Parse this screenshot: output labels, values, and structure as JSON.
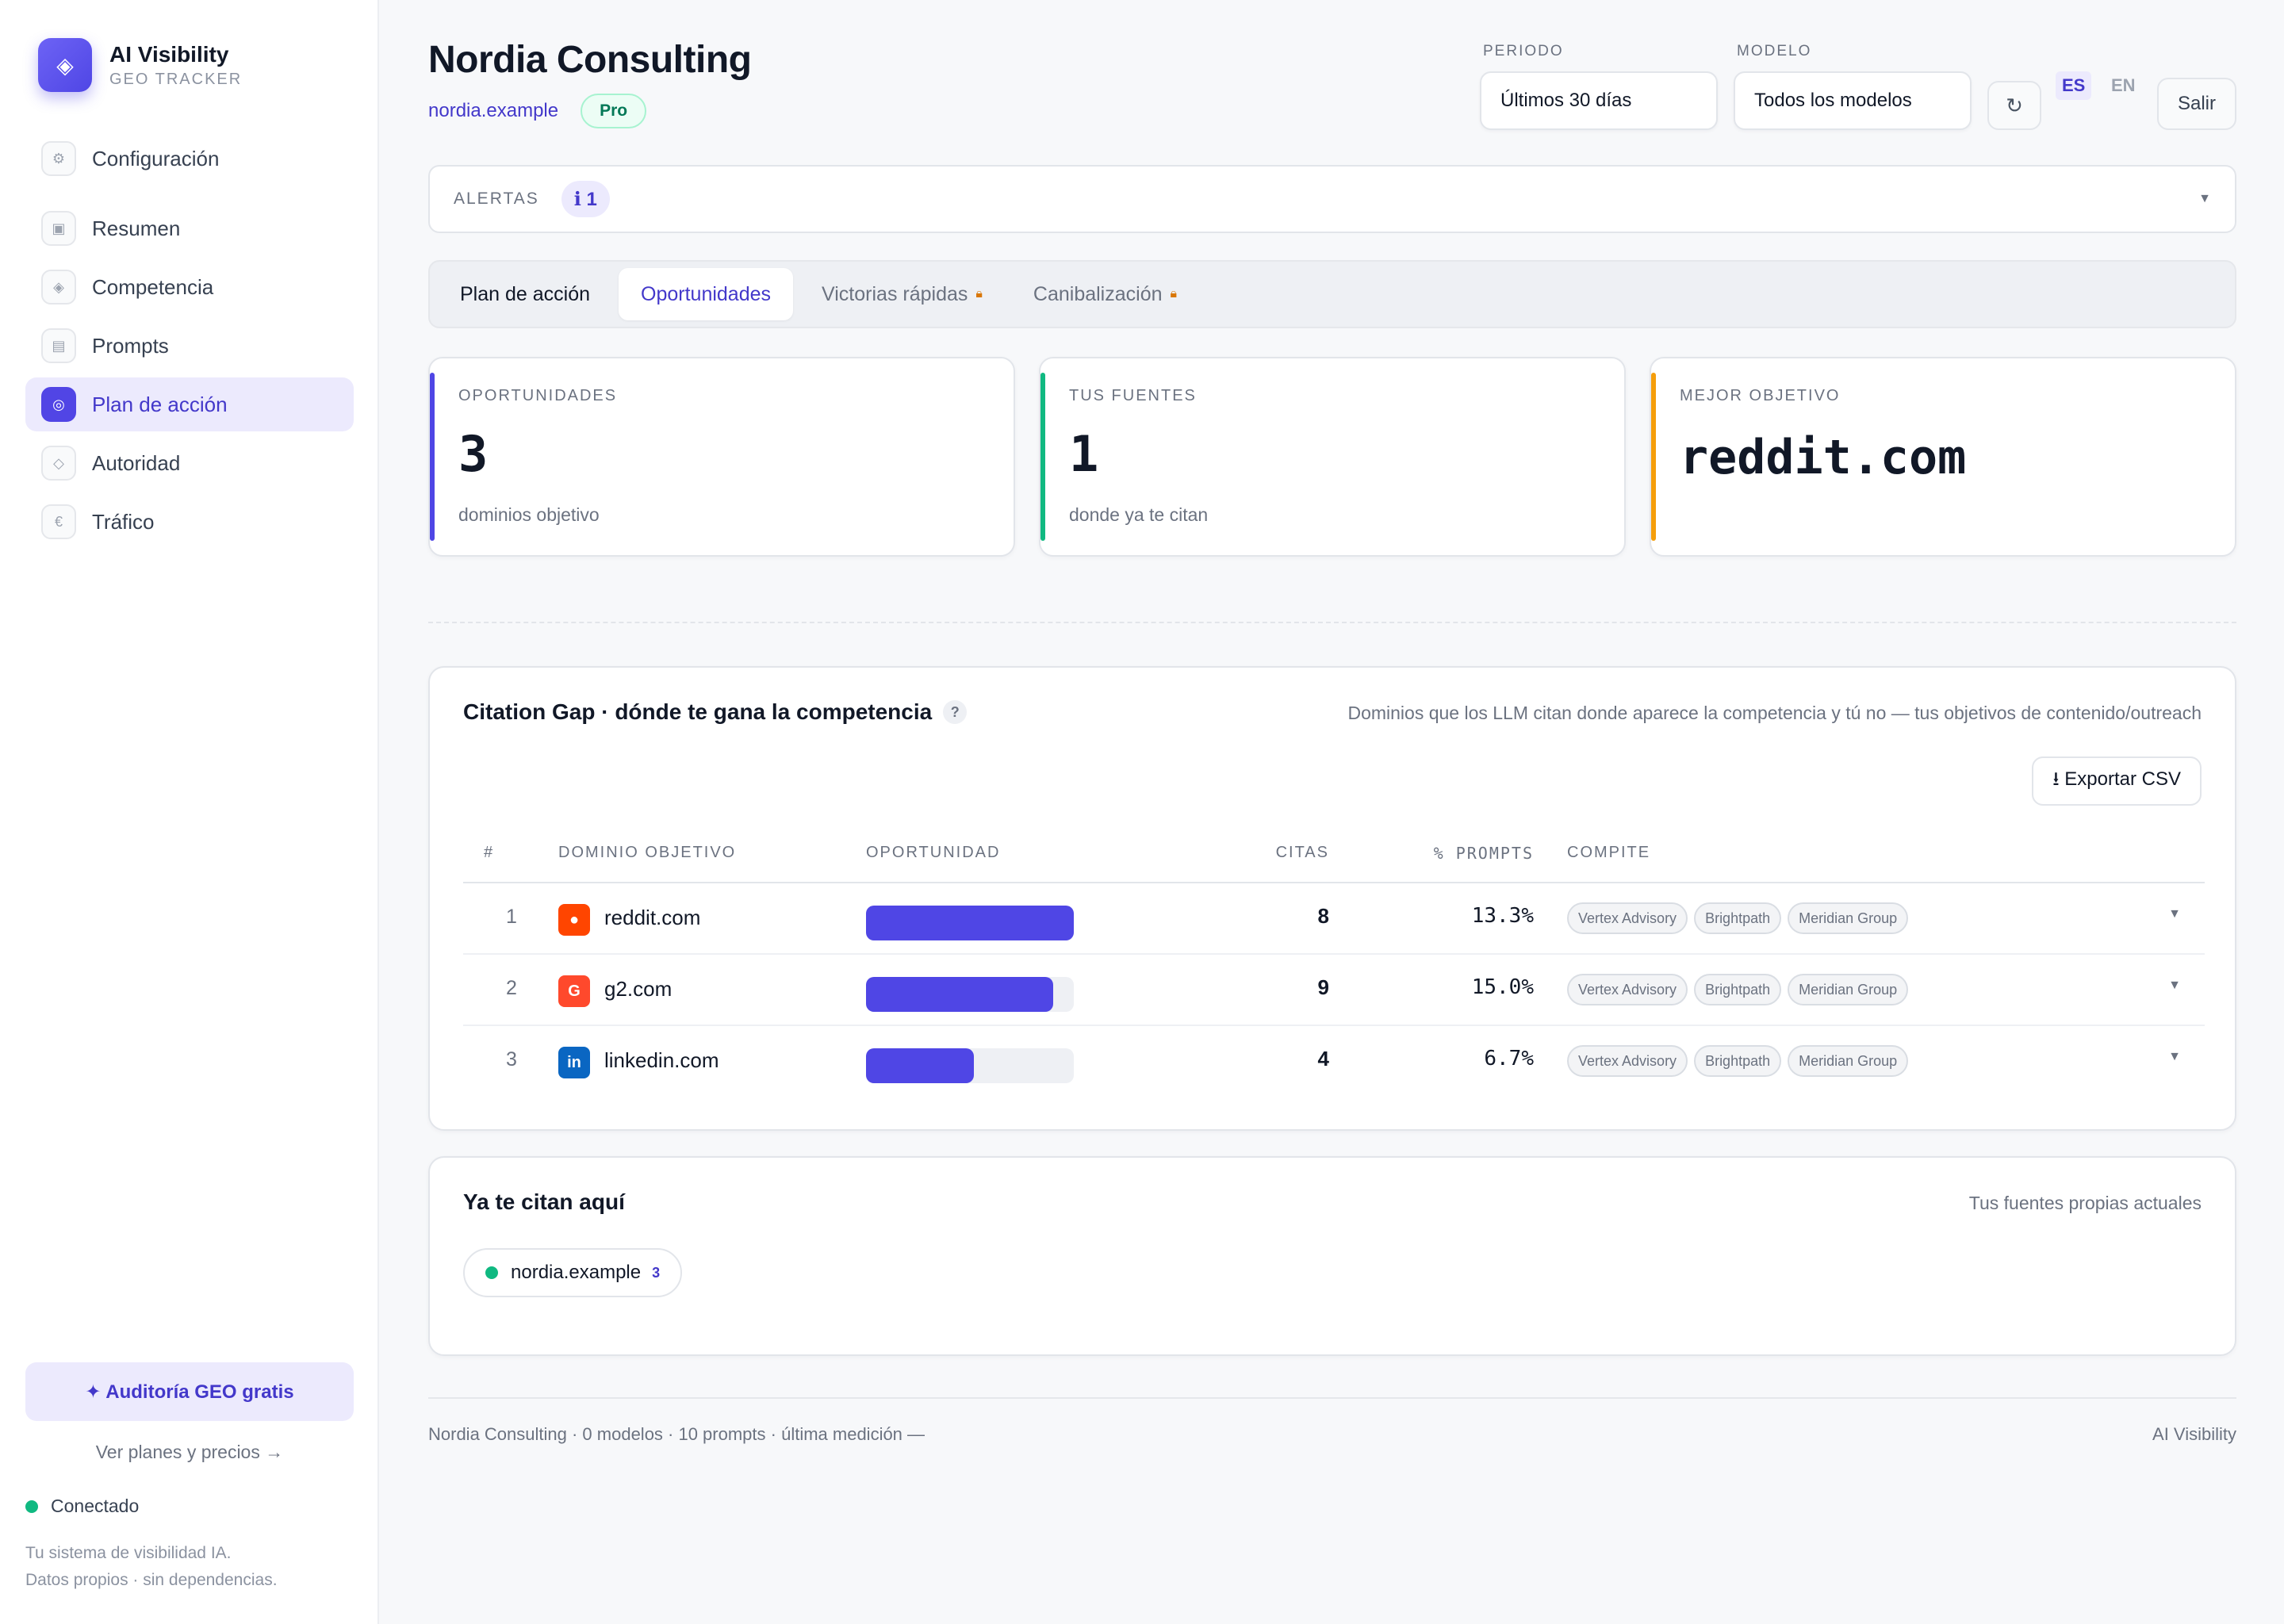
{
  "brand": {
    "name": "AI Visibility",
    "subtitle": "GEO TRACKER"
  },
  "sidebar": {
    "items": [
      {
        "label": "Configuración",
        "icon": "gear-icon",
        "glyph": "⚙"
      },
      {
        "label": "Resumen",
        "icon": "grid-icon",
        "glyph": "▣"
      },
      {
        "label": "Competencia",
        "icon": "diamond-icon",
        "glyph": "◈"
      },
      {
        "label": "Prompts",
        "icon": "list-icon",
        "glyph": "▤"
      },
      {
        "label": "Plan de acción",
        "icon": "target-icon",
        "glyph": "◎",
        "active": true
      },
      {
        "label": "Autoridad",
        "icon": "rhombus-icon",
        "glyph": "◇"
      },
      {
        "label": "Tráfico",
        "icon": "euro-icon",
        "glyph": "€"
      }
    ],
    "audit_button": "✦ Auditoría GEO gratis",
    "plans_link": "Ver planes y precios →",
    "status": "Conectado",
    "footer_line1": "Tu sistema de visibilidad IA.",
    "footer_line2": "Datos propios · sin dependencias."
  },
  "header": {
    "title": "Nordia Consulting",
    "site": "nordia.example",
    "plan": "Pro",
    "period_label": "PERIODO",
    "period_value": "Últimos 30 días",
    "model_label": "MODELO",
    "model_value": "Todos los modelos",
    "refresh_glyph": "↻",
    "lang_es": "ES",
    "lang_en": "EN",
    "logout": "Salir"
  },
  "alerts": {
    "label": "ALERTAS",
    "count": "ℹ 1"
  },
  "tabs": [
    {
      "label": "Plan de acción"
    },
    {
      "label": "Oportunidades",
      "active": true
    },
    {
      "label": "Victorias rápidas",
      "locked": true
    },
    {
      "label": "Canibalización",
      "locked": true
    }
  ],
  "kpis": [
    {
      "label": "OPORTUNIDADES",
      "value": "3",
      "sub": "dominios objetivo",
      "color": "#4f46e5"
    },
    {
      "label": "TUS FUENTES",
      "value": "1",
      "sub": "donde ya te citan",
      "color": "#10b981"
    },
    {
      "label": "MEJOR OBJETIVO",
      "value": "reddit.com",
      "sub": "",
      "color": "#f59e0b"
    }
  ],
  "citation_gap": {
    "title": "Citation Gap · dónde te gana la competencia",
    "help": "?",
    "description": "Dominios que los LLM citan donde aparece la competencia y tú no — tus objetivos de contenido/outreach",
    "export": "⭳ Exportar CSV",
    "columns": {
      "idx": "#",
      "domain": "DOMINIO OBJETIVO",
      "opportunity": "OPORTUNIDAD",
      "cites": "CITAS",
      "pct": "% PROMPTS",
      "competitors": "COMPITE"
    },
    "rows": [
      {
        "idx": "1",
        "domain": "reddit.com",
        "favicon": "reddit-icon",
        "favicon_color": "#ff4500",
        "favicon_glyph": "●",
        "opportunity": 1.0,
        "cites": "8",
        "pct": "13.3%",
        "competitors": [
          "Vertex Advisory",
          "Brightpath",
          "Meridian Group"
        ]
      },
      {
        "idx": "2",
        "domain": "g2.com",
        "favicon": "g2-icon",
        "favicon_color": "#ff492c",
        "favicon_glyph": "G",
        "opportunity": 0.9,
        "cites": "9",
        "pct": "15.0%",
        "competitors": [
          "Vertex Advisory",
          "Brightpath",
          "Meridian Group"
        ]
      },
      {
        "idx": "3",
        "domain": "linkedin.com",
        "favicon": "linkedin-icon",
        "favicon_color": "#0a66c2",
        "favicon_glyph": "in",
        "opportunity": 0.52,
        "cites": "4",
        "pct": "6.7%",
        "competitors": [
          "Vertex Advisory",
          "Brightpath",
          "Meridian Group"
        ]
      }
    ]
  },
  "own_sources": {
    "title": "Ya te citan aquí",
    "description": "Tus fuentes propias actuales",
    "items": [
      {
        "domain": "nordia.example",
        "count": "3"
      }
    ]
  },
  "footer": {
    "left": "Nordia Consulting · 0 modelos · 10 prompts · última medición —",
    "right": "AI Visibility"
  }
}
